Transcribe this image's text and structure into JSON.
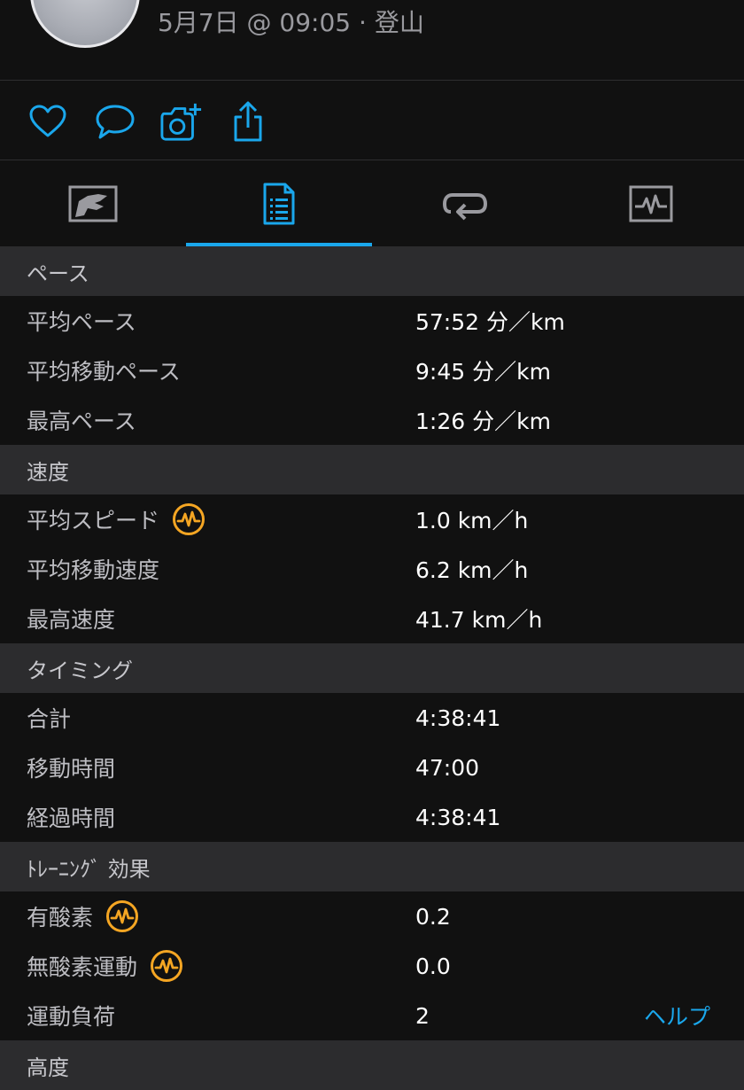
{
  "header": {
    "date_time": "5月7日 @ 09:05",
    "separator": "·",
    "activity_type": "登山"
  },
  "actions": [
    {
      "name": "like",
      "icon": "heart-icon"
    },
    {
      "name": "comment",
      "icon": "comment-icon"
    },
    {
      "name": "add-photo",
      "icon": "camera-plus-icon"
    },
    {
      "name": "share",
      "icon": "share-icon"
    }
  ],
  "tabs": [
    {
      "name": "map",
      "icon": "map-icon",
      "active": false
    },
    {
      "name": "stats",
      "icon": "document-list-icon",
      "active": true
    },
    {
      "name": "laps",
      "icon": "loop-icon",
      "active": false
    },
    {
      "name": "charts",
      "icon": "chart-icon",
      "active": false
    }
  ],
  "colors": {
    "accent": "#1aa7ec",
    "badge": "#f5a623",
    "section_bg": "#2c2c2e",
    "background": "#111111"
  },
  "sections": [
    {
      "title": "ペース",
      "rows": [
        {
          "label": "平均ペース",
          "value": "57:52 分／km"
        },
        {
          "label": "平均移動ペース",
          "value": "9:45 分／km"
        },
        {
          "label": "最高ペース",
          "value": "1:26 分／km"
        }
      ]
    },
    {
      "title": "速度",
      "rows": [
        {
          "label": "平均スピード",
          "value": "1.0 km／h",
          "badge": "pulse-badge-icon"
        },
        {
          "label": "平均移動速度",
          "value": "6.2 km／h"
        },
        {
          "label": "最高速度",
          "value": "41.7 km／h"
        }
      ]
    },
    {
      "title": "タイミング",
      "rows": [
        {
          "label": "合計",
          "value": "4:38:41"
        },
        {
          "label": "移動時間",
          "value": "47:00"
        },
        {
          "label": "経過時間",
          "value": "4:38:41"
        }
      ]
    },
    {
      "title": "ﾄﾚｰﾆﾝｸﾞ 効果",
      "rows": [
        {
          "label": "有酸素",
          "value": "0.2",
          "badge": "pulse-badge-icon"
        },
        {
          "label": "無酸素運動",
          "value": "0.0",
          "badge": "pulse-badge-icon"
        },
        {
          "label": "運動負荷",
          "value": "2",
          "help": "ヘルプ"
        }
      ]
    },
    {
      "title": "高度",
      "rows": []
    }
  ]
}
